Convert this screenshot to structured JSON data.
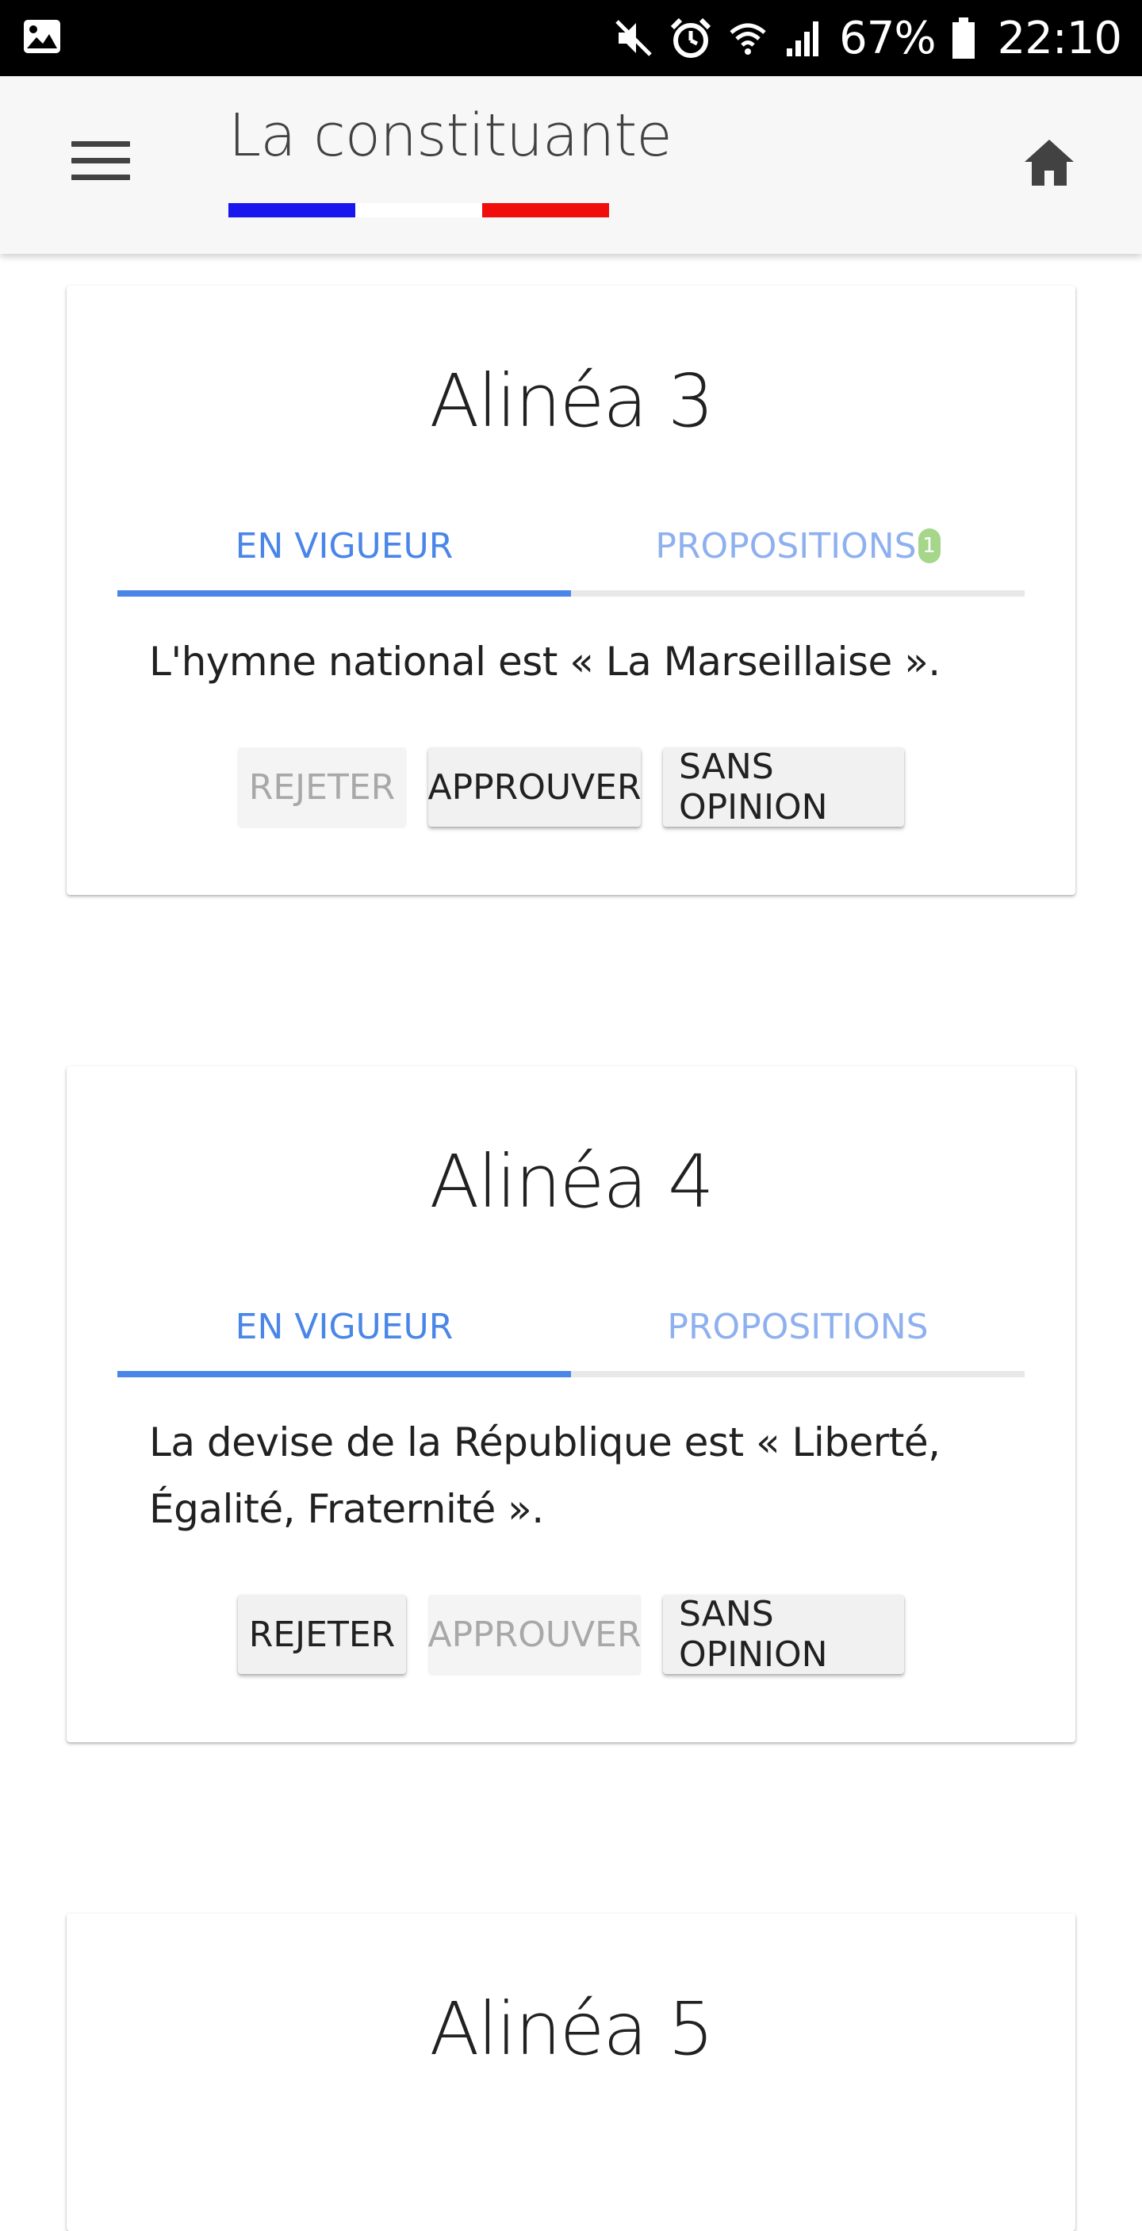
{
  "status_bar": {
    "left_icon": "image-icon",
    "icons": [
      "mute-icon",
      "alarm-icon",
      "wifi-icon",
      "signal-icon",
      "battery-icon"
    ],
    "battery": "67%",
    "time": "22:10"
  },
  "app_bar": {
    "title": "La constituante",
    "flag_colors": [
      "#1a17ee",
      "#ffffff",
      "#f20d0d"
    ],
    "menu_icon": "menu-icon",
    "home_icon": "home-icon"
  },
  "articles": [
    {
      "title": "Alinéa 3",
      "tabs": {
        "active": "EN VIGUEUR",
        "other": "PROPOSITIONS",
        "badge": "1"
      },
      "text": "L'hymne national est « La Marseillaise ».",
      "buttons": {
        "reject": "REJETER",
        "approve": "APPROUVER",
        "neutral": "SANS OPINION"
      },
      "disabled": "reject"
    },
    {
      "title": "Alinéa 4",
      "tabs": {
        "active": "EN VIGUEUR",
        "other": "PROPOSITIONS"
      },
      "text": "La devise de la République est « Liberté, Égalité, Fraternité ».",
      "buttons": {
        "reject": "REJETER",
        "approve": "APPROUVER",
        "neutral": "SANS OPINION"
      },
      "disabled": "approve"
    },
    {
      "title": "Alinéa 5"
    }
  ],
  "colors": {
    "accent": "#4a86e8",
    "accent_light": "#8fb0ef",
    "badge": "#a5d68a"
  }
}
